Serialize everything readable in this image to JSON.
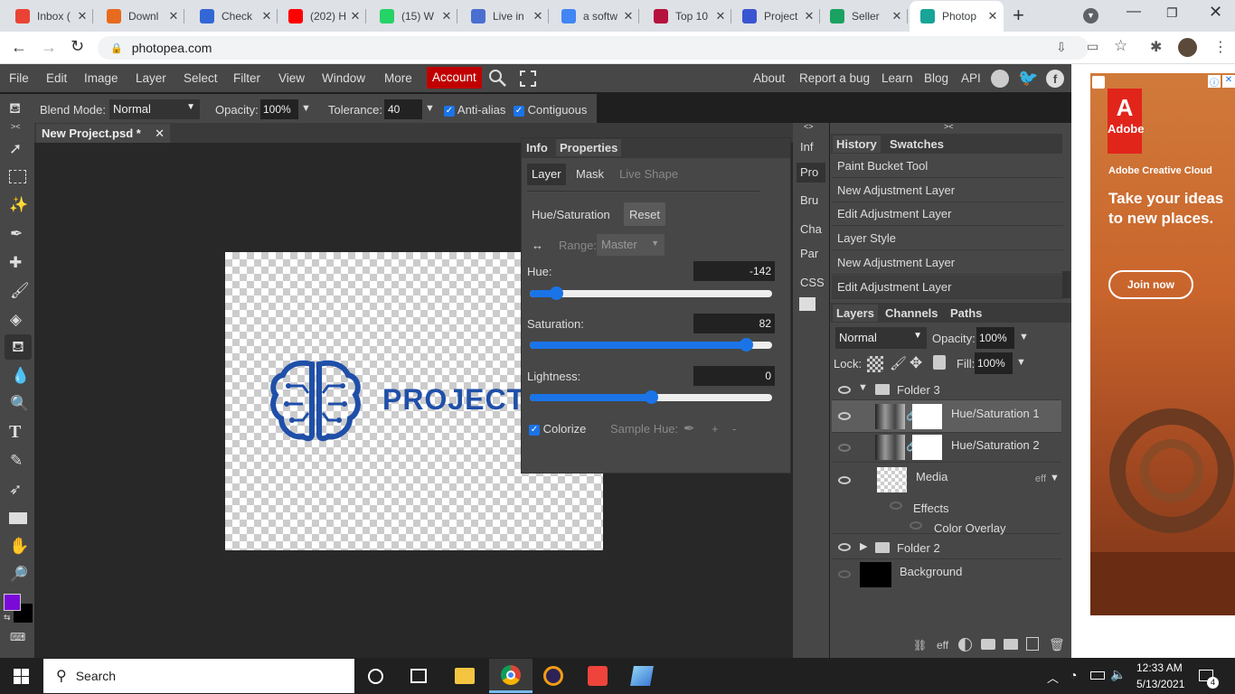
{
  "browser": {
    "tabs": [
      {
        "title": "Inbox (",
        "icon": "gmail-icon",
        "color": "#ea4335"
      },
      {
        "title": "Downl",
        "icon": "download-site-icon",
        "color": "#e86a1f"
      },
      {
        "title": "Check",
        "icon": "check-site-icon",
        "color": "#3367d6"
      },
      {
        "title": "(202) H",
        "icon": "youtube-icon",
        "color": "#ff0000"
      },
      {
        "title": "(15) W",
        "icon": "whatsapp-icon",
        "color": "#25d366"
      },
      {
        "title": "Live in",
        "icon": "live-site-icon",
        "color": "#4a6fd1"
      },
      {
        "title": "a softw",
        "icon": "google-icon",
        "color": "#4285f4"
      },
      {
        "title": "Top 10",
        "icon": "top10-site-icon",
        "color": "#b5123e"
      },
      {
        "title": "Project",
        "icon": "project-site-icon",
        "color": "#3a55d1"
      },
      {
        "title": "Seller",
        "icon": "seller-site-icon",
        "color": "#1aa260"
      },
      {
        "title": "Photop",
        "icon": "photopea-icon",
        "color": "#18a497"
      }
    ],
    "new_tab": "+",
    "url": "photopea.com"
  },
  "menu": {
    "items": [
      "File",
      "Edit",
      "Image",
      "Layer",
      "Select",
      "Filter",
      "View",
      "Window",
      "More"
    ],
    "account": "Account",
    "right": [
      "About",
      "Report a bug",
      "Learn",
      "Blog",
      "API"
    ]
  },
  "tool_options": {
    "blend_label": "Blend Mode:",
    "blend_value": "Normal",
    "opacity_label": "Opacity:",
    "opacity_value": "100%",
    "tolerance_label": "Tolerance:",
    "tolerance_value": "40",
    "antialias_label": "Anti-alias",
    "contiguous_label": "Contiguous"
  },
  "document": {
    "tab_title": "New Project.psd *",
    "logo_text": "PROJECTSI"
  },
  "properties": {
    "tab_info": "Info",
    "tab_properties": "Properties",
    "subtabs": [
      "Layer",
      "Mask",
      "Live Shape"
    ],
    "adjustment": "Hue/Saturation",
    "reset": "Reset",
    "range_label": "Range:",
    "range_value": "Master",
    "hue_label": "Hue:",
    "hue_value": "-142",
    "hue_level": 0.11,
    "sat_label": "Saturation:",
    "sat_value": "82",
    "sat_level": 0.89,
    "light_label": "Lightness:",
    "light_value": "0",
    "light_level": 0.5,
    "colorize_label": "Colorize",
    "sample_hue_label": "Sample Hue:",
    "plus": "+",
    "minus": "-"
  },
  "side_tabs": [
    "Inf",
    "Pro",
    "Bru",
    "Cha",
    "Par",
    "CSS"
  ],
  "history": {
    "tab_history": "History",
    "tab_swatches": "Swatches",
    "items": [
      "Paint Bucket Tool",
      "New Adjustment Layer",
      "Edit Adjustment Layer",
      "Layer Style",
      "New Adjustment Layer",
      "Edit Adjustment Layer"
    ]
  },
  "layers": {
    "tabs": [
      "Layers",
      "Channels",
      "Paths"
    ],
    "blend": "Normal",
    "opacity_label": "Opacity:",
    "opacity_value": "100%",
    "lock_label": "Lock:",
    "fill_label": "Fill:",
    "fill_value": "100%",
    "folder3": "Folder 3",
    "hs1": "Hue/Saturation 1",
    "hs2": "Hue/Saturation 2",
    "media": "Media",
    "eff": "eff",
    "effects": "Effects",
    "color_overlay": "Color Overlay",
    "folder2": "Folder 2",
    "background": "Background",
    "footer_eff": "eff"
  },
  "ad": {
    "brand": "Adobe",
    "product": "Adobe Creative Cloud",
    "headline": "Take your ideas to new places.",
    "cta": "Join now"
  },
  "taskbar": {
    "search": "Search",
    "time": "12:33 AM",
    "date": "5/13/2021",
    "notif_count": "4"
  },
  "colors": {
    "accent": "#1a74e8",
    "account_red": "#c00000",
    "foreground": "#7a0ad8",
    "logo_blue": "#1f4fa8"
  }
}
